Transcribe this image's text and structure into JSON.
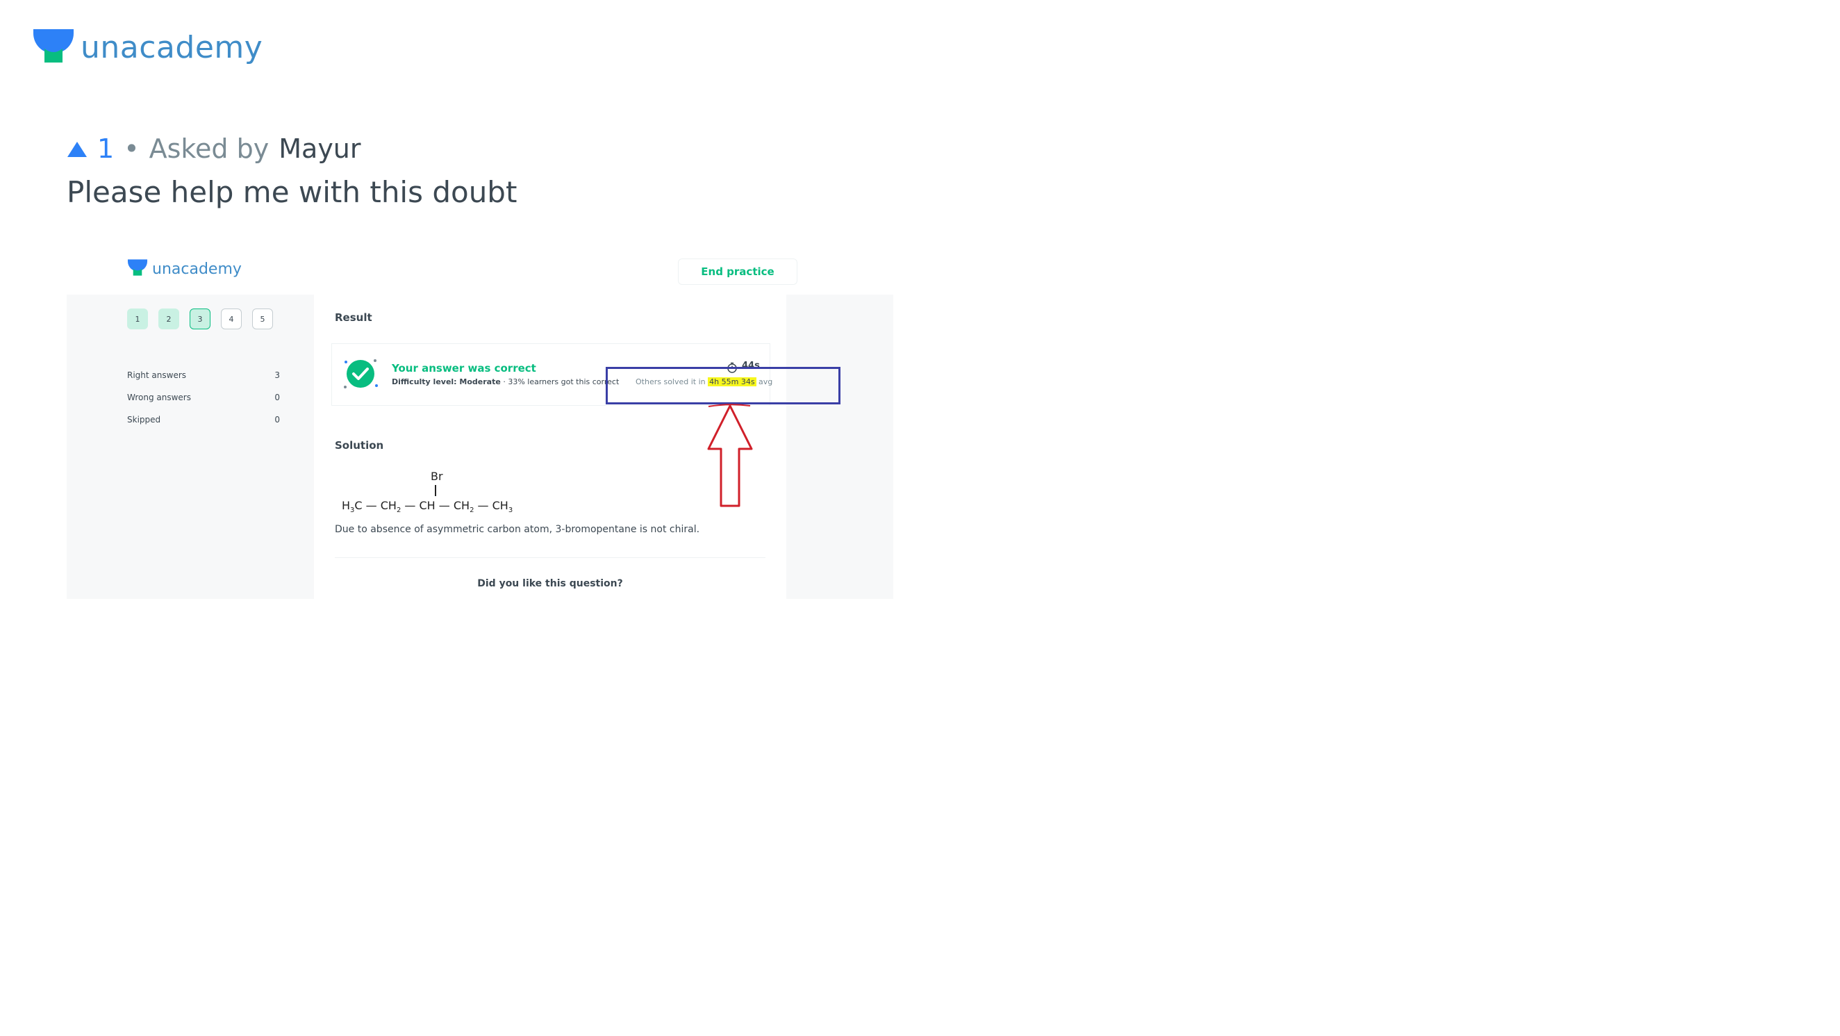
{
  "brand": {
    "name": "unacademy",
    "color": "#3f8cc8",
    "icon": "unacademy-logo-icon"
  },
  "question": {
    "upvote_icon": "upvote-triangle-icon",
    "upvote_count": "1",
    "separator": "•",
    "asked_by_label": "Asked by",
    "asker": "Mayur",
    "text": "Please help me with this doubt"
  },
  "screenshot": {
    "brand_name": "unacademy",
    "end_practice": "End practice",
    "question_numbers": [
      "1",
      "2",
      "3",
      "4",
      "5"
    ],
    "stats": [
      {
        "label": "Right answers",
        "value": "3"
      },
      {
        "label": "Wrong answers",
        "value": "0"
      },
      {
        "label": "Skipped",
        "value": "0"
      }
    ],
    "result_label": "Result",
    "correct_title": "Your answer was correct",
    "difficulty_label": "Difficulty level: Moderate",
    "difficulty_note": "· 33% learners got this correct",
    "time_taken": "44s",
    "others_prefix": "Others solved it in",
    "others_time": "4h 55m 34s",
    "others_suffix": "avg",
    "solution_label": "Solution",
    "formula_br": "Br",
    "explanation": "Due to absence of asymmetric carbon atom, 3-bromopentane is not chiral.",
    "like_question": "Did you like this question?"
  },
  "colors": {
    "accent_green": "#08bd80",
    "annotation_blue": "#3a3fa6",
    "annotation_red": "#d0202a",
    "upvote_blue": "#2d81f7",
    "highlight": "#f7f71d"
  }
}
